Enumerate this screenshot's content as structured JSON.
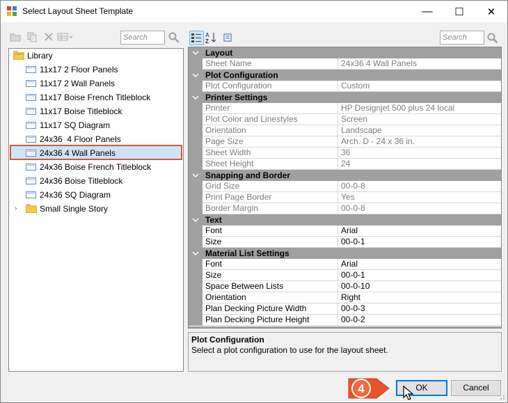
{
  "window": {
    "title": "Select Layout Sheet Template",
    "minimize_glyph": "—",
    "maximize_glyph": "☐",
    "close_glyph": "✕"
  },
  "left_panel": {
    "search_placeholder": "Search",
    "tree": {
      "root_label": "Library",
      "items": [
        {
          "label": "11x17 2 Floor Panels",
          "icon": "page-icon"
        },
        {
          "label": "11x17 2 Wall Panels",
          "icon": "page-icon"
        },
        {
          "label": "11x17 Boise French Titleblock",
          "icon": "page-icon"
        },
        {
          "label": "11x17 Boise Titleblock",
          "icon": "page-icon"
        },
        {
          "label": "11x17 SQ Diagram",
          "icon": "page-icon"
        },
        {
          "label": "24x36  4 Floor Panels",
          "icon": "page-icon"
        },
        {
          "label": "24x36 4 Wall Panels",
          "icon": "page-icon",
          "selected": true
        },
        {
          "label": "24x36 Boise French Titleblock",
          "icon": "page-icon"
        },
        {
          "label": "24x36 Boise Titleblock",
          "icon": "page-icon"
        },
        {
          "label": "24x36 SQ Diagram",
          "icon": "page-icon"
        }
      ],
      "folder_label": "Small Single Story"
    }
  },
  "right_panel": {
    "search_placeholder": "Search",
    "categories": [
      {
        "name": "Layout",
        "props": [
          {
            "name": "Sheet Name",
            "value": "24x36 4 Wall Panels",
            "readonly": true
          }
        ]
      },
      {
        "name": "Plot Configuration",
        "props": [
          {
            "name": "Plot Configuration",
            "value": "Custom",
            "readonly": true
          }
        ]
      },
      {
        "name": "Printer Settings",
        "props": [
          {
            "name": "Printer",
            "value": "HP Designjet 500 plus 24 local",
            "readonly": true
          },
          {
            "name": "Plot Color and Linestyles",
            "value": "Screen",
            "readonly": true
          },
          {
            "name": "Orientation",
            "value": "Landscape",
            "readonly": true
          },
          {
            "name": "Page Size",
            "value": "Arch. D - 24 x 36 in.",
            "readonly": true
          },
          {
            "name": "Sheet Width",
            "value": "36",
            "readonly": true
          },
          {
            "name": "Sheet Height",
            "value": "24",
            "readonly": true
          }
        ]
      },
      {
        "name": "Snapping and Border",
        "props": [
          {
            "name": "Grid Size",
            "value": "00-0-8",
            "readonly": true
          },
          {
            "name": "Print Page Border",
            "value": "Yes",
            "readonly": true
          },
          {
            "name": "Border Margin",
            "value": "00-0-8",
            "readonly": true
          }
        ]
      },
      {
        "name": "Text",
        "props": [
          {
            "name": "Font",
            "value": "Arial",
            "readonly": false
          },
          {
            "name": "Size",
            "value": "00-0-1",
            "readonly": false
          }
        ]
      },
      {
        "name": "Material List Settings",
        "props": [
          {
            "name": "Font",
            "value": "Arial",
            "readonly": false
          },
          {
            "name": "Size",
            "value": "00-0-1",
            "readonly": false
          },
          {
            "name": "Space Between Lists",
            "value": "00-0-10",
            "readonly": false
          },
          {
            "name": "Orientation",
            "value": "Right",
            "readonly": false
          },
          {
            "name": "Plan Decking Picture Width",
            "value": "00-0-3",
            "readonly": false
          },
          {
            "name": "Plan Decking Picture Height",
            "value": "00-0-2",
            "readonly": false
          }
        ]
      }
    ],
    "description": {
      "title": "Plot Configuration",
      "text": "Select a plot configuration to use for the layout sheet."
    }
  },
  "footer": {
    "ok_label": "OK",
    "cancel_label": "Cancel",
    "step_badge": "4"
  },
  "colors": {
    "selection": "#cce4f7",
    "highlight_border": "#d9553b",
    "badge": "#e8532b",
    "category_bg": "#a0a0a0"
  }
}
